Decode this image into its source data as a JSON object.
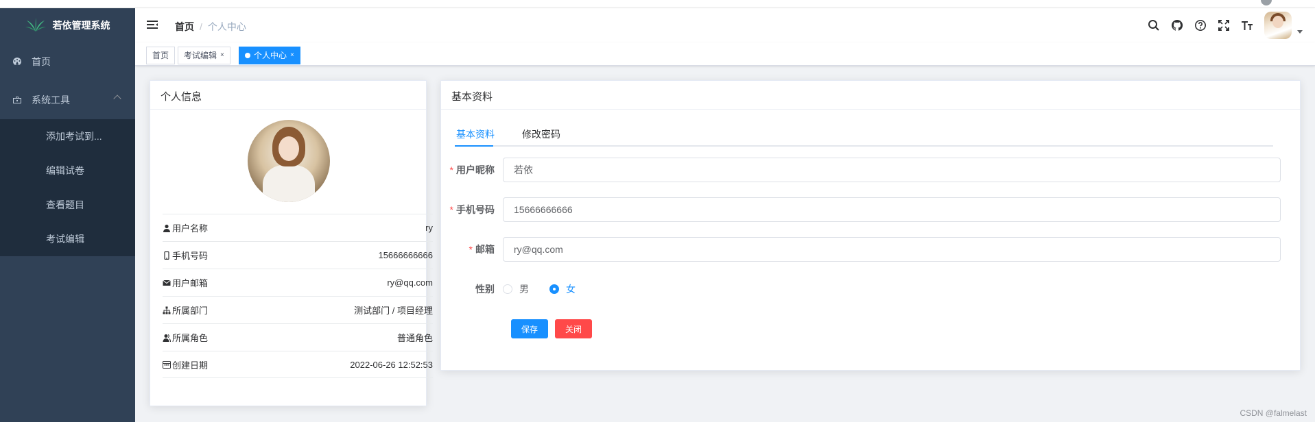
{
  "app": {
    "title": "若依管理系统"
  },
  "sidebar": {
    "items": [
      {
        "label": "首页",
        "icon": "dashboard-icon"
      },
      {
        "label": "系统工具",
        "icon": "toolbox-icon"
      }
    ],
    "submenu": [
      "添加考试到...",
      "编辑试卷",
      "查看题目",
      "考试编辑"
    ]
  },
  "navbar": {
    "breadcrumb": [
      "首页",
      "个人中心"
    ],
    "separator": "/",
    "icons": [
      "search-icon",
      "github-icon",
      "question-icon",
      "fullscreen-icon",
      "font-size-icon"
    ]
  },
  "tags": [
    {
      "label": "首页"
    },
    {
      "label": "考试编辑",
      "close": "×"
    },
    {
      "label": "个人中心",
      "close": "×",
      "active": true
    }
  ],
  "profile": {
    "title": "个人信息",
    "rows": [
      {
        "label": "用户名称",
        "value": "ry",
        "icon": "user-icon"
      },
      {
        "label": "手机号码",
        "value": "15666666666",
        "icon": "phone-icon"
      },
      {
        "label": "用户邮箱",
        "value": "ry@qq.com",
        "icon": "mail-icon"
      },
      {
        "label": "所属部门",
        "value": "测试部门 / 项目经理",
        "icon": "tree-icon"
      },
      {
        "label": "所属角色",
        "value": "普通角色",
        "icon": "peoples-icon"
      },
      {
        "label": "创建日期",
        "value": "2022-06-26 12:52:53",
        "icon": "date-icon"
      }
    ]
  },
  "basic": {
    "title": "基本资料",
    "tabs": [
      "基本资料",
      "修改密码"
    ],
    "fields": [
      {
        "label": "用户昵称",
        "value": "若依",
        "required": "*"
      },
      {
        "label": "手机号码",
        "value": "15666666666",
        "required": "*"
      },
      {
        "label": "邮箱",
        "value": "ry@qq.com",
        "required": "*"
      }
    ],
    "gender": {
      "label": "性别",
      "options": [
        "男",
        "女"
      ],
      "selected": "女"
    },
    "buttons": {
      "save": "保存",
      "close": "关闭"
    }
  },
  "colors": {
    "primary": "#1890ff",
    "danger": "#ff4949",
    "sidebar": "#304156"
  },
  "watermark": "CSDN @falmelast"
}
